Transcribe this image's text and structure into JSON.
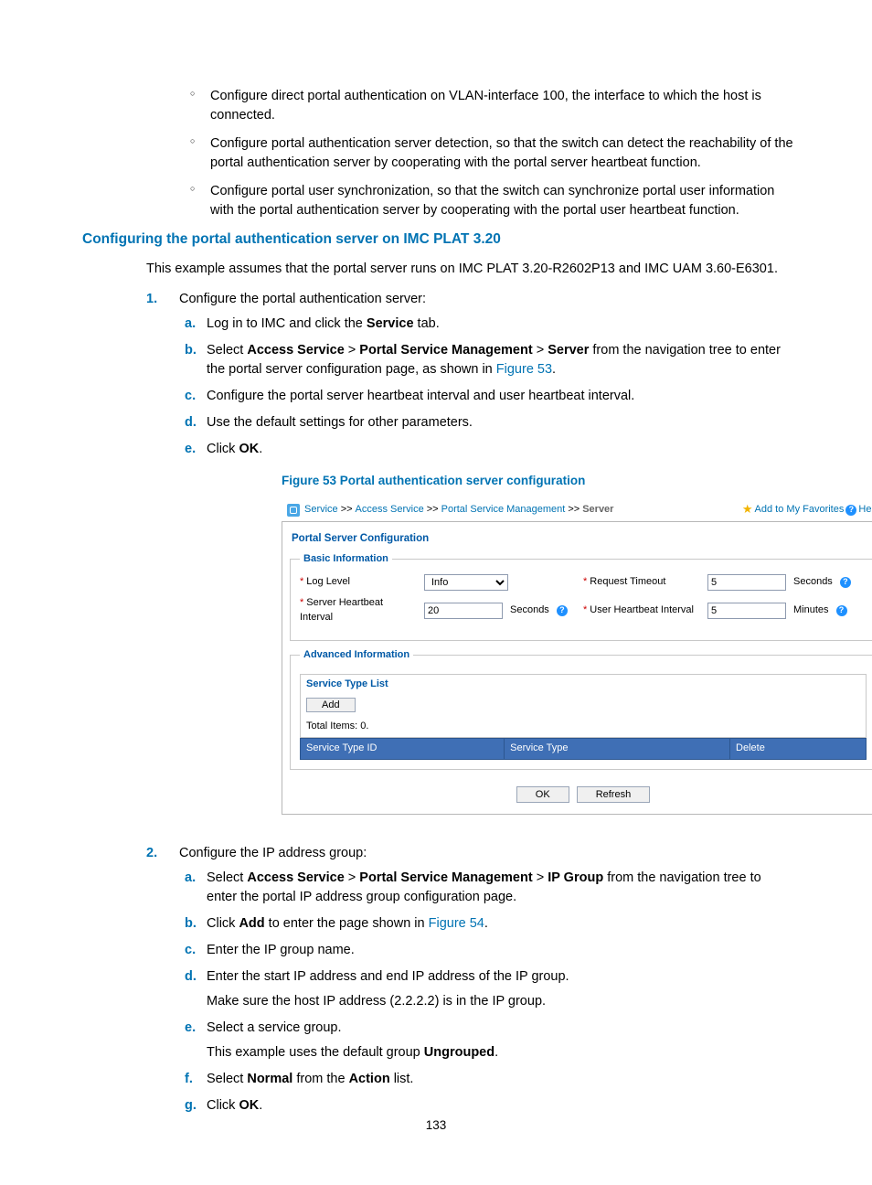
{
  "bullets_top": [
    "Configure direct portal authentication on VLAN-interface 100, the interface to which the host is connected.",
    "Configure portal authentication server detection, so that the switch can detect the reachability of the portal authentication server by cooperating with the portal server heartbeat function.",
    "Configure portal user synchronization, so that the switch can synchronize portal user information with the portal authentication server by cooperating with the portal user heartbeat function."
  ],
  "h2": "Configuring the portal authentication server on IMC PLAT 3.20",
  "intro": "This example assumes that the portal server runs on IMC PLAT 3.20-R2602P13 and IMC UAM 3.60-E6301.",
  "step1": {
    "num": "1.",
    "text": "Configure the portal authentication server:",
    "a": {
      "m": "a.",
      "pre": "Log in to IMC and click the ",
      "bold": "Service",
      "post": " tab."
    },
    "b": {
      "m": "b.",
      "t1": "Select ",
      "b1": "Access Service",
      "t2": " > ",
      "b2": "Portal Service Management",
      "t3": " > ",
      "b3": "Server",
      "t4": " from the navigation tree to enter the portal server configuration page, as shown in ",
      "lnk": "Figure 53",
      "t5": "."
    },
    "c": {
      "m": "c.",
      "text": "Configure the portal server heartbeat interval and user heartbeat interval."
    },
    "d": {
      "m": "d.",
      "text": "Use the default settings for other parameters."
    },
    "e": {
      "m": "e.",
      "pre": "Click ",
      "bold": "OK",
      "post": "."
    }
  },
  "figcap": "Figure 53 Portal authentication server configuration",
  "fig": {
    "bc": {
      "l1": "Service",
      "l2": "Access Service",
      "l3": "Portal Service Management",
      "cur": "Server",
      "fav": "Add to My Favorites",
      "help": "Help",
      "sep": ">>"
    },
    "panelTitle": "Portal Server Configuration",
    "basic": {
      "legend": "Basic Information",
      "loglevel_lbl": "Log Level",
      "loglevel_val": "Info",
      "reqto_lbl": "Request Timeout",
      "reqto_val": "5",
      "reqto_unit": "Seconds",
      "shb_lbl": "Server Heartbeat Interval",
      "shb_val": "20",
      "shb_unit": "Seconds",
      "uhb_lbl": "User Heartbeat Interval",
      "uhb_val": "5",
      "uhb_unit": "Minutes"
    },
    "adv": {
      "legend": "Advanced Information",
      "listTitle": "Service Type List",
      "add": "Add",
      "total": "Total Items: 0.",
      "h1": "Service Type ID",
      "h2": "Service Type",
      "h3": "Delete"
    },
    "ok": "OK",
    "refresh": "Refresh"
  },
  "step2": {
    "num": "2.",
    "text": "Configure the IP address group:",
    "a": {
      "m": "a.",
      "t1": "Select ",
      "b1": "Access Service",
      "t2": " > ",
      "b2": "Portal Service Management",
      "t3": " > ",
      "b3": "IP Group",
      "t4": " from the navigation tree to enter the portal IP address group configuration page."
    },
    "b": {
      "m": "b.",
      "t1": "Click ",
      "b1": "Add",
      "t2": " to enter the page shown in ",
      "lnk": "Figure 54",
      "t3": "."
    },
    "c": {
      "m": "c.",
      "text": "Enter the IP group name."
    },
    "d": {
      "m": "d.",
      "text": "Enter the start IP address and end IP address of the IP group.",
      "sub": "Make sure the host IP address (2.2.2.2) is in the IP group."
    },
    "e": {
      "m": "e.",
      "text": "Select a service group.",
      "sub_pre": "This example uses the default group ",
      "sub_bold": "Ungrouped",
      "sub_post": "."
    },
    "f": {
      "m": "f.",
      "t1": "Select ",
      "b1": "Normal",
      "t2": " from the ",
      "b2": "Action",
      "t3": " list."
    },
    "g": {
      "m": "g.",
      "pre": "Click ",
      "bold": "OK",
      "post": "."
    }
  },
  "pagenum": "133"
}
